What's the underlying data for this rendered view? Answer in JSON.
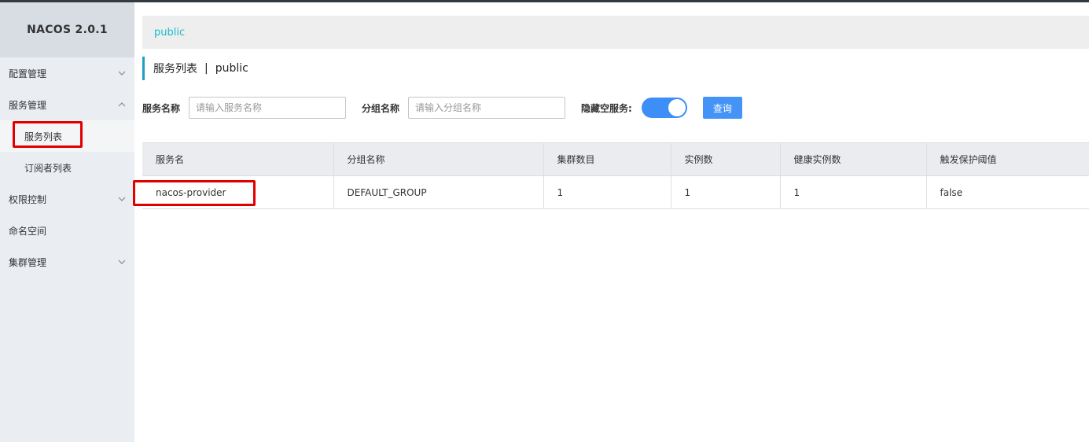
{
  "app": {
    "logo": "NACOS 2.0.1"
  },
  "sidebar": {
    "items": [
      {
        "label": "配置管理"
      },
      {
        "label": "服务管理"
      },
      {
        "label": "服务列表"
      },
      {
        "label": "订阅者列表"
      },
      {
        "label": "权限控制"
      },
      {
        "label": "命名空间"
      },
      {
        "label": "集群管理"
      }
    ]
  },
  "namespace_bar": {
    "current": "public"
  },
  "page": {
    "title": "服务列表",
    "separator": "|",
    "namespace": "public"
  },
  "filters": {
    "service_name_label": "服务名称",
    "service_name_placeholder": "请输入服务名称",
    "group_name_label": "分组名称",
    "group_name_placeholder": "请输入分组名称",
    "hide_empty_label": "隐藏空服务:",
    "hide_empty_on": true,
    "query_button": "查询"
  },
  "table": {
    "headers": [
      "服务名",
      "分组名称",
      "集群数目",
      "实例数",
      "健康实例数",
      "触发保护阈值"
    ],
    "rows": [
      [
        "nacos-provider",
        "DEFAULT_GROUP",
        "1",
        "1",
        "1",
        "false"
      ]
    ]
  },
  "colors": {
    "accent": "#3e8ef7",
    "link": "#18bbc9",
    "highlight": "#e00000"
  }
}
